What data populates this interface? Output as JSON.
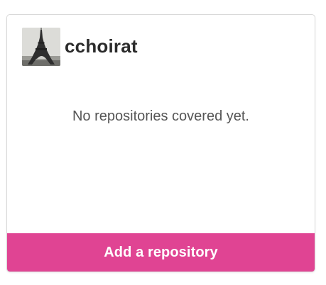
{
  "card": {
    "username": "cchoirat",
    "avatar_icon": "eiffel-tower-photo-icon",
    "empty_message": "No repositories covered yet.",
    "add_button_label": "Add a repository"
  },
  "colors": {
    "accent": "#e04493",
    "text_primary": "#2b2b2b",
    "text_secondary": "#555555",
    "border": "#d9d9d9"
  }
}
